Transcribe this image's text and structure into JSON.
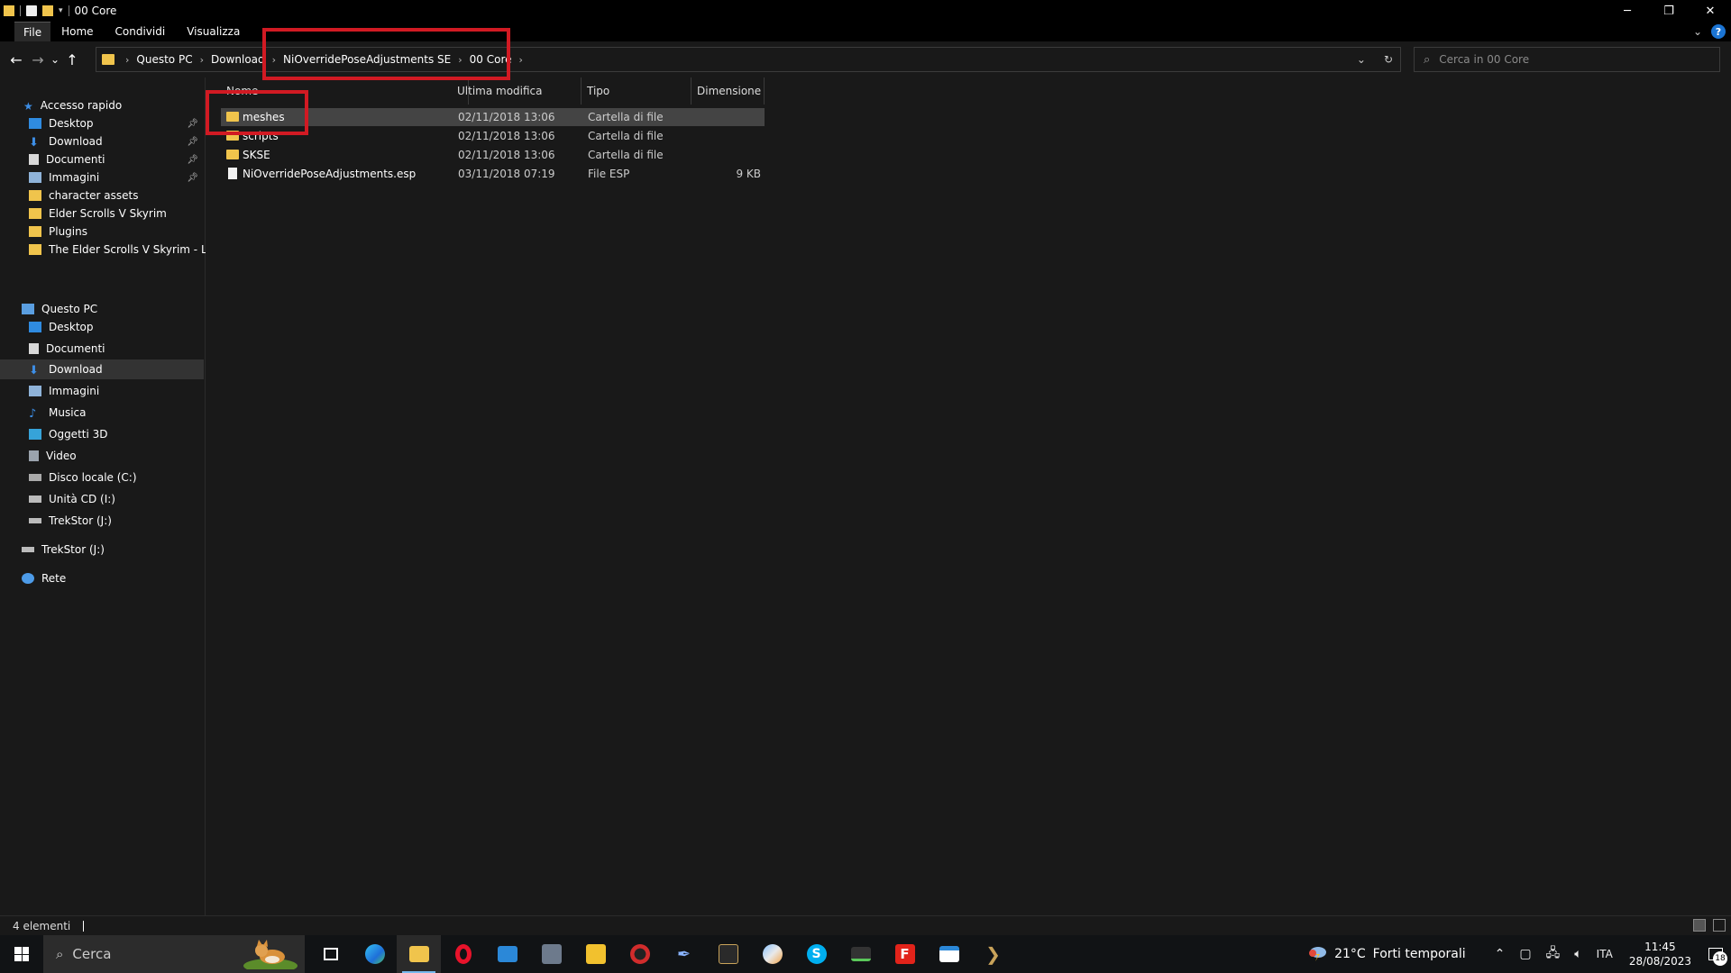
{
  "window": {
    "title": "00 Core",
    "controls": {
      "minimize": "─",
      "restore": "❐",
      "close": "✕"
    }
  },
  "ribbon": {
    "tabs": [
      "File",
      "Home",
      "Condividi",
      "Visualizza"
    ],
    "help": "?"
  },
  "nav_buttons": {
    "back": "←",
    "forward": "→",
    "recent": "⌄",
    "up": "↑"
  },
  "address": {
    "crumbs": [
      "Questo PC",
      "Download",
      "NiOverridePoseAdjustments SE",
      "00 Core"
    ],
    "dropdown": "⌄",
    "refresh": "↻"
  },
  "search": {
    "placeholder": "Cerca in 00 Core",
    "icon": "search-icon"
  },
  "navpane": {
    "quick_access": {
      "label": "Accesso rapido",
      "items": [
        {
          "label": "Desktop",
          "icon": "desktop-icon",
          "pinned": true
        },
        {
          "label": "Download",
          "icon": "download-icon",
          "pinned": true
        },
        {
          "label": "Documenti",
          "icon": "documents-icon",
          "pinned": true
        },
        {
          "label": "Immagini",
          "icon": "pictures-icon",
          "pinned": true
        },
        {
          "label": "character assets",
          "icon": "folder-icon",
          "pinned": false
        },
        {
          "label": "Elder Scrolls V  Skyrim",
          "icon": "folder-icon",
          "pinned": false
        },
        {
          "label": "Plugins",
          "icon": "folder-icon",
          "pinned": false
        },
        {
          "label": "The Elder Scrolls V Skyrim - Leger",
          "icon": "folder-icon",
          "pinned": false
        }
      ]
    },
    "this_pc": {
      "label": "Questo PC",
      "items": [
        {
          "label": "Desktop",
          "icon": "desktop-icon"
        },
        {
          "label": "Documenti",
          "icon": "documents-icon"
        },
        {
          "label": "Download",
          "icon": "download-icon",
          "selected": true
        },
        {
          "label": "Immagini",
          "icon": "pictures-icon"
        },
        {
          "label": "Musica",
          "icon": "music-icon"
        },
        {
          "label": "Oggetti 3D",
          "icon": "objects-3d-icon"
        },
        {
          "label": "Video",
          "icon": "video-icon"
        },
        {
          "label": "Disco locale (C:)",
          "icon": "drive-icon"
        },
        {
          "label": "Unità CD (I:)",
          "icon": "cd-drive-icon"
        },
        {
          "label": "TrekStor (J:)",
          "icon": "usb-drive-icon"
        }
      ]
    },
    "trekstor": {
      "label": "TrekStor (J:)",
      "icon": "usb-drive-icon"
    },
    "network": {
      "label": "Rete",
      "icon": "network-icon"
    }
  },
  "columns": {
    "name": "Nome",
    "modified": "Ultima modifica",
    "type": "Tipo",
    "size": "Dimensione"
  },
  "files": [
    {
      "name": "meshes",
      "modified": "02/11/2018 13:06",
      "type": "Cartella di file",
      "size": "",
      "kind": "folder",
      "selected": true
    },
    {
      "name": "scripts",
      "modified": "02/11/2018 13:06",
      "type": "Cartella di file",
      "size": "",
      "kind": "folder"
    },
    {
      "name": "SKSE",
      "modified": "02/11/2018 13:06",
      "type": "Cartella di file",
      "size": "",
      "kind": "folder"
    },
    {
      "name": "NiOverridePoseAdjustments.esp",
      "modified": "03/11/2018 07:19",
      "type": "File ESP",
      "size": "9 KB",
      "kind": "file"
    }
  ],
  "status": {
    "count": "4 elementi"
  },
  "taskbar": {
    "search_placeholder": "Cerca",
    "apps": [
      "task-view",
      "edge",
      "file-explorer",
      "opera",
      "store",
      "game-launcher",
      "notes",
      "steam-like",
      "quill",
      "creation-kit",
      "paint",
      "skype",
      "mod-manager",
      "foxit",
      "app-window",
      "arrow-app"
    ],
    "weather": {
      "temp": "21°C",
      "desc": "Forti temporali"
    },
    "language": "ITA",
    "time": "11:45",
    "date": "28/08/2023",
    "notifications": "18"
  },
  "colors": {
    "highlight": "#d11a23",
    "folder": "#f0c44c",
    "accent": "#1b74d3"
  }
}
